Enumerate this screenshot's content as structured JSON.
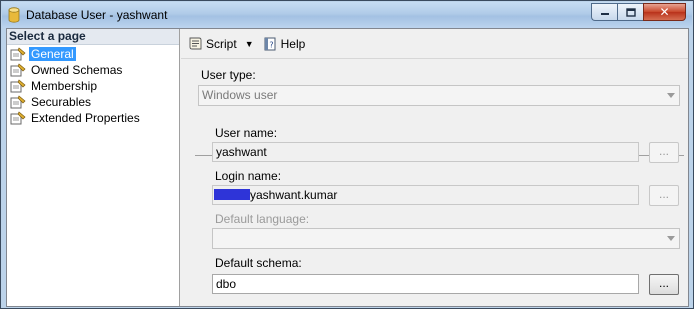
{
  "window": {
    "title": "Database User - yashwant",
    "icon": "database-cylinder-icon",
    "controls": {
      "minimize": "minimize-icon",
      "maximize": "maximize-icon",
      "close": "close-icon"
    }
  },
  "sidebar": {
    "header": "Select a page",
    "items": [
      {
        "label": "General",
        "icon": "page-wrench-icon",
        "selected": true
      },
      {
        "label": "Owned Schemas",
        "icon": "page-wrench-icon",
        "selected": false
      },
      {
        "label": "Membership",
        "icon": "page-wrench-icon",
        "selected": false
      },
      {
        "label": "Securables",
        "icon": "page-wrench-icon",
        "selected": false
      },
      {
        "label": "Extended Properties",
        "icon": "page-wrench-icon",
        "selected": false
      }
    ]
  },
  "toolbar": {
    "script_label": "Script",
    "help_label": "Help"
  },
  "form": {
    "user_type_label": "User type:",
    "user_type_value": "Windows user",
    "user_name_label": "User name:",
    "user_name_value": "yashwant",
    "login_name_label": "Login name:",
    "login_name_value": "yashwant.kumar",
    "default_language_label": "Default language:",
    "default_language_value": "",
    "default_schema_label": "Default schema:",
    "default_schema_value": "dbo",
    "ellipsis_label": "..."
  },
  "colors": {
    "selection": "#3399ff",
    "redaction": "#2e34d8",
    "title_bar": "#b0cbe8",
    "close_button": "#c8462a"
  }
}
